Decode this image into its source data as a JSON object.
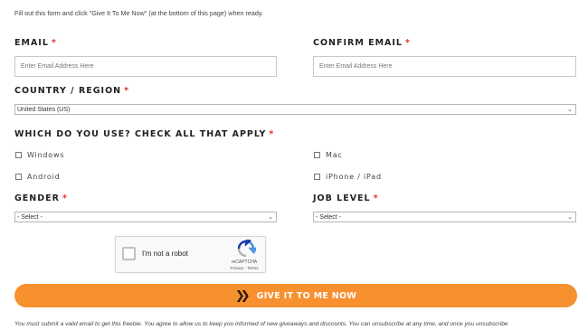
{
  "intro": "Fill out this form and click \"Give It To Me Now\" (at the bottom of this page) when ready.",
  "email": {
    "label": "EMAIL",
    "placeholder": "Enter Email Address Here"
  },
  "confirm_email": {
    "label": "CONFIRM EMAIL",
    "placeholder": "Enter Email Address Here"
  },
  "required_mark": "*",
  "country": {
    "label": "COUNTRY / REGION",
    "selected": "United States (US)"
  },
  "platforms": {
    "label": "WHICH DO YOU USE? CHECK ALL THAT APPLY",
    "options": [
      "Windows",
      "Mac",
      "Android",
      "iPhone / iPad"
    ]
  },
  "gender": {
    "label": "GENDER",
    "selected": "- Select -"
  },
  "job_level": {
    "label": "JOB LEVEL",
    "selected": "- Select -"
  },
  "recaptcha": {
    "text": "I'm not a robot",
    "brand": "reCAPTCHA",
    "links": "Privacy - Terms"
  },
  "submit": {
    "label": "GIVE IT TO ME NOW"
  },
  "disclaimer": "You must submit a valid email to get this freebie. You agree to allow us to keep you informed of new giveaways and discounts. You can unsubscribe at any time, and once you unsubscribe",
  "colors": {
    "accent": "#f7902f",
    "required": "#e23030"
  }
}
